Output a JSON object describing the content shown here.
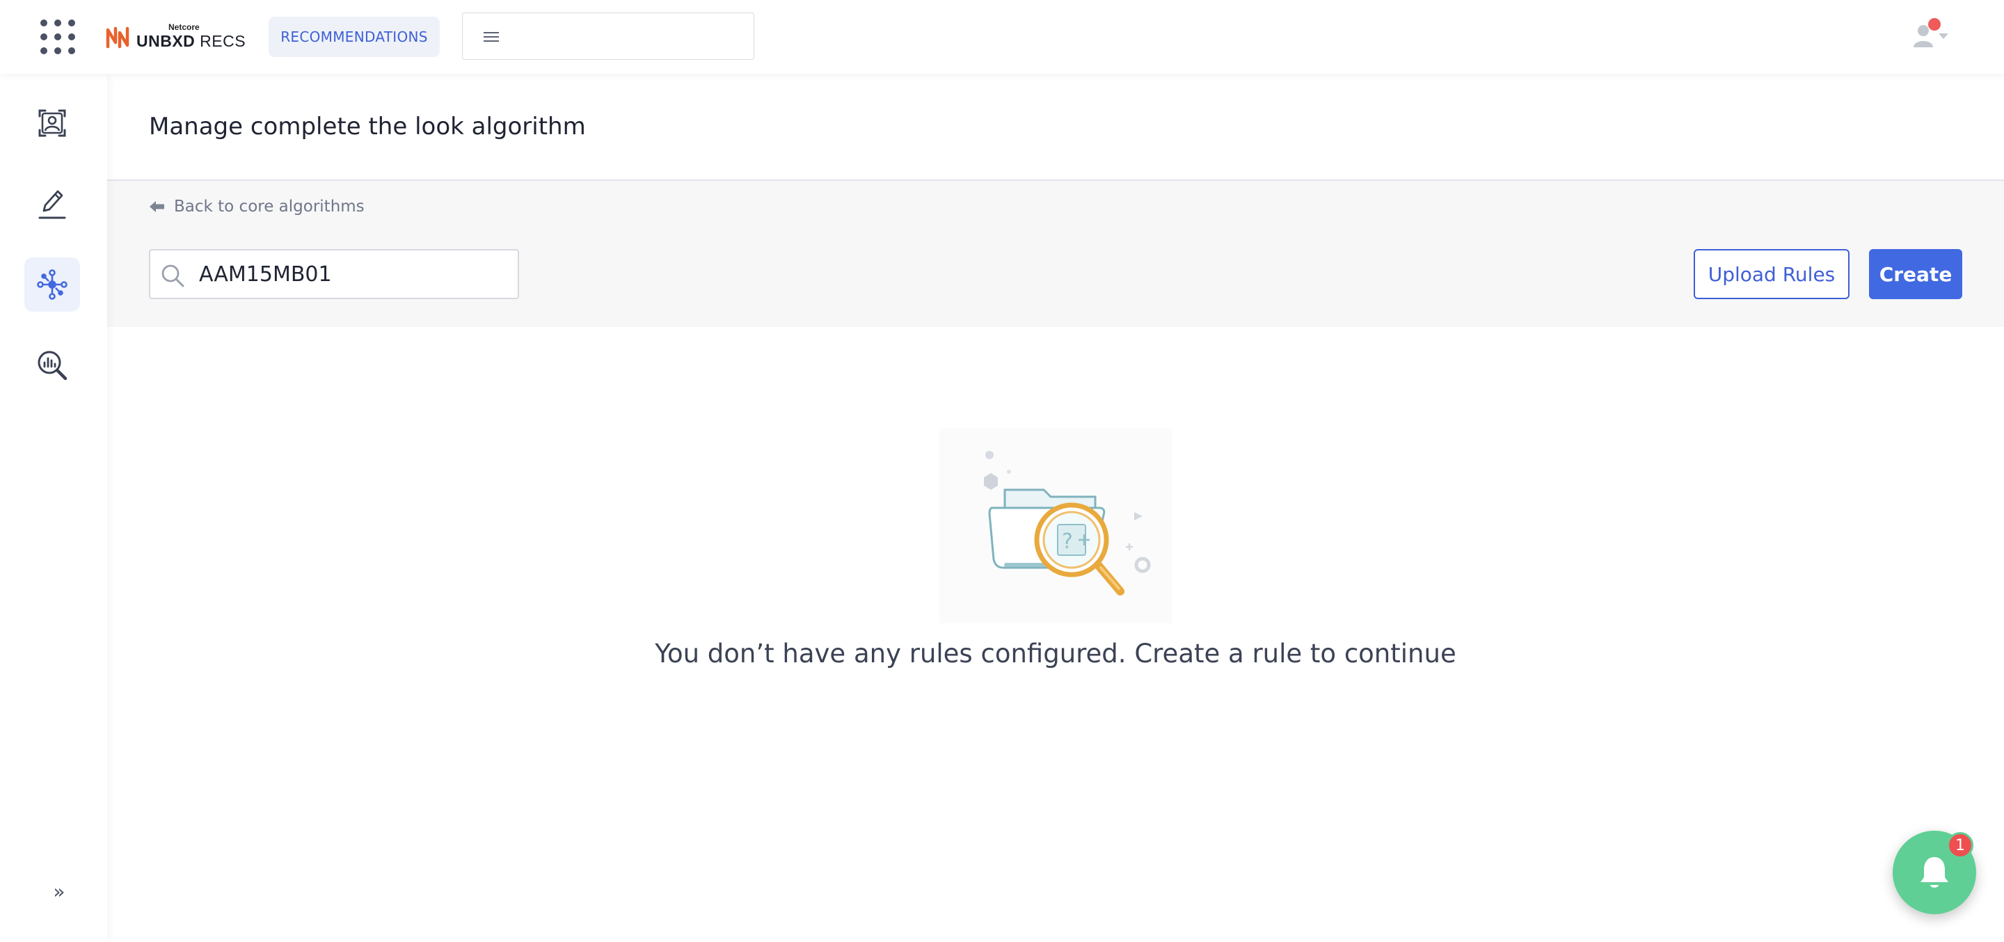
{
  "header": {
    "logo_small": "Netcore",
    "logo_brand": "UNBXD",
    "logo_product": "RECS",
    "module_label": "RECOMMENDATIONS",
    "site_selector_value": ""
  },
  "sidebar": {
    "items": [
      {
        "name": "users",
        "icon": "user-frame-icon",
        "active": false
      },
      {
        "name": "editor",
        "icon": "pencil-icon",
        "active": false
      },
      {
        "name": "algorithms",
        "icon": "network-icon",
        "active": true
      },
      {
        "name": "analytics",
        "icon": "analytics-search-icon",
        "active": false
      }
    ],
    "expand_icon": "double-chevron-right-icon",
    "expand_glyph": "»"
  },
  "page": {
    "title": "Manage complete the look algorithm",
    "back_link": "Back to core algorithms"
  },
  "search": {
    "value": "AAM15MB01",
    "placeholder": ""
  },
  "actions": {
    "upload_label": "Upload Rules",
    "create_label": "Create"
  },
  "empty_state": {
    "message": "You don’t have any rules configured. Create a rule to continue"
  },
  "notifications": {
    "count": "1"
  },
  "colors": {
    "primary": "#4169e1",
    "fab": "#5fcf95",
    "badge": "#ef4f4f",
    "logo_orange": "#e8622c"
  }
}
